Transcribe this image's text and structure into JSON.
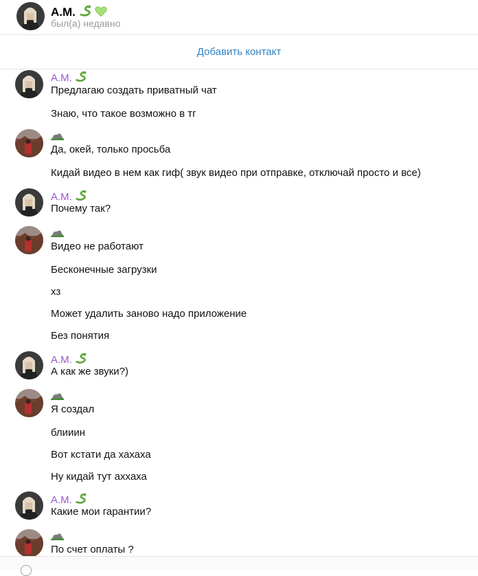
{
  "header": {
    "name": "А.М.",
    "status": "был(а) недавно"
  },
  "add_contact": "Добавить контакт",
  "senders": {
    "am": "А.М."
  },
  "messages": [
    "Предлагаю создать приватный чат",
    "Знаю, что такое возможно в тг",
    "Да, окей, только просьба",
    "Кидай видео в нем как гиф( звук видео при отправке, отключай просто и все)",
    "Почему так?",
    "Видео не работают",
    "Бесконечные загрузки",
    "хз",
    "Может удалить заново надо приложение",
    "Без понятия",
    "А как же звуки?)",
    "Я создал",
    "блииин",
    "Вот кстати да хахаха",
    "Ну кидай тут аххаха",
    "Какие мои гарантии?",
    "По счет оплаты ?"
  ],
  "colors": {
    "accent_link": "#2e84c6",
    "sender_name": "#9b59d0",
    "status_gray": "#9a9a9a"
  },
  "icons": {
    "snake": "snake-icon",
    "heart": "green-heart-icon",
    "mountain": "mountain-icon"
  }
}
